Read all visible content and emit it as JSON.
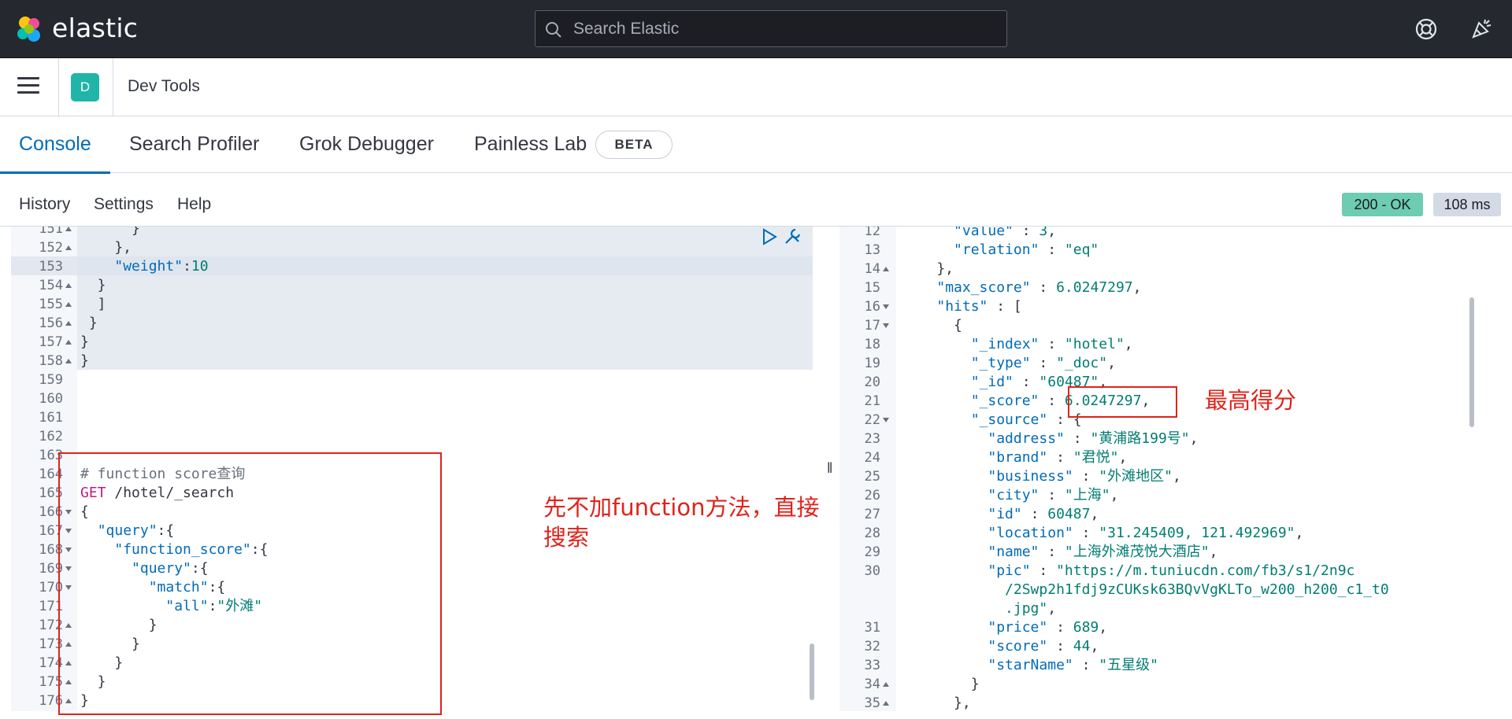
{
  "header": {
    "brand": "elastic",
    "search_placeholder": "Search Elastic",
    "icons": [
      "elastic-logo-icon",
      "search-icon",
      "help-icon",
      "newsfeed-icon"
    ]
  },
  "breadcrumb": {
    "avatar_letter": "D",
    "title": "Dev Tools"
  },
  "tabs": [
    {
      "label": "Console",
      "active": true
    },
    {
      "label": "Search Profiler"
    },
    {
      "label": "Grok Debugger"
    },
    {
      "label": "Painless Lab"
    }
  ],
  "beta_badge": "BETA",
  "menu": [
    "History",
    "Settings",
    "Help"
  ],
  "status": {
    "code": "200 - OK",
    "time": "108 ms"
  },
  "colors": {
    "accent": "#006bb8",
    "status_ok": "#6dccb1",
    "annotation": "#e0231b"
  },
  "left_editor": {
    "lines": [
      {
        "n": "151",
        "fold": "up",
        "indent": 2,
        "tokens": [
          [
            "p",
            "      }"
          ]
        ]
      },
      {
        "n": "152",
        "fold": "up",
        "tokens": [
          [
            "p",
            "    },"
          ]
        ]
      },
      {
        "n": "153",
        "tokens": [
          [
            "p",
            "    "
          ],
          [
            "k",
            "\"weight\""
          ],
          [
            "p",
            ":"
          ],
          [
            "s",
            "10"
          ]
        ]
      },
      {
        "n": "154",
        "fold": "up",
        "tokens": [
          [
            "p",
            "  }"
          ]
        ]
      },
      {
        "n": "155",
        "fold": "up",
        "tokens": [
          [
            "p",
            "  ]"
          ]
        ]
      },
      {
        "n": "156",
        "fold": "up",
        "tokens": [
          [
            "p",
            " }"
          ]
        ]
      },
      {
        "n": "157",
        "fold": "up",
        "tokens": [
          [
            "p",
            "}"
          ]
        ]
      },
      {
        "n": "158",
        "fold": "up",
        "tokens": [
          [
            "p",
            "}"
          ]
        ]
      },
      {
        "n": "159",
        "tokens": []
      },
      {
        "n": "160",
        "tokens": []
      },
      {
        "n": "161",
        "tokens": []
      },
      {
        "n": "162",
        "tokens": []
      },
      {
        "n": "163",
        "tokens": []
      },
      {
        "n": "164",
        "tokens": [
          [
            "c",
            "# function score查询"
          ]
        ]
      },
      {
        "n": "165",
        "tokens": [
          [
            "m",
            "GET"
          ],
          [
            "p",
            " /hotel/_search"
          ]
        ]
      },
      {
        "n": "166",
        "fold": "down",
        "tokens": [
          [
            "p",
            "{"
          ]
        ]
      },
      {
        "n": "167",
        "fold": "down",
        "tokens": [
          [
            "p",
            "  "
          ],
          [
            "k",
            "\"query\""
          ],
          [
            "p",
            ":{"
          ]
        ]
      },
      {
        "n": "168",
        "fold": "down",
        "tokens": [
          [
            "p",
            "    "
          ],
          [
            "k",
            "\"function_score\""
          ],
          [
            "p",
            ":{"
          ]
        ]
      },
      {
        "n": "169",
        "fold": "down",
        "tokens": [
          [
            "p",
            "      "
          ],
          [
            "k",
            "\"query\""
          ],
          [
            "p",
            ":{"
          ]
        ]
      },
      {
        "n": "170",
        "fold": "down",
        "tokens": [
          [
            "p",
            "        "
          ],
          [
            "k",
            "\"match\""
          ],
          [
            "p",
            ":{"
          ]
        ]
      },
      {
        "n": "171",
        "tokens": [
          [
            "p",
            "          "
          ],
          [
            "k",
            "\"all\""
          ],
          [
            "p",
            ":"
          ],
          [
            "s",
            "\"外滩\""
          ]
        ]
      },
      {
        "n": "172",
        "fold": "up",
        "tokens": [
          [
            "p",
            "        }"
          ]
        ]
      },
      {
        "n": "173",
        "fold": "up",
        "tokens": [
          [
            "p",
            "      }"
          ]
        ]
      },
      {
        "n": "174",
        "fold": "up",
        "tokens": [
          [
            "p",
            "    }"
          ]
        ]
      },
      {
        "n": "175",
        "fold": "up",
        "tokens": [
          [
            "p",
            "  }"
          ]
        ]
      },
      {
        "n": "176",
        "fold": "up",
        "tokens": [
          [
            "p",
            "}"
          ]
        ]
      }
    ]
  },
  "right_editor": {
    "lines": [
      {
        "n": "12",
        "tokens": [
          [
            "p",
            "      "
          ],
          [
            "k",
            "\"value\""
          ],
          [
            "p",
            " : "
          ],
          [
            "s",
            "3"
          ],
          [
            "p",
            ","
          ]
        ]
      },
      {
        "n": "13",
        "tokens": [
          [
            "p",
            "      "
          ],
          [
            "k",
            "\"relation\""
          ],
          [
            "p",
            " : "
          ],
          [
            "s",
            "\"eq\""
          ]
        ]
      },
      {
        "n": "14",
        "fold": "up",
        "tokens": [
          [
            "p",
            "    },"
          ]
        ]
      },
      {
        "n": "15",
        "tokens": [
          [
            "p",
            "    "
          ],
          [
            "k",
            "\"max_score\""
          ],
          [
            "p",
            " : "
          ],
          [
            "s",
            "6.0247297"
          ],
          [
            "p",
            ","
          ]
        ]
      },
      {
        "n": "16",
        "fold": "down",
        "tokens": [
          [
            "p",
            "    "
          ],
          [
            "k",
            "\"hits\""
          ],
          [
            "p",
            " : ["
          ]
        ]
      },
      {
        "n": "17",
        "fold": "down",
        "tokens": [
          [
            "p",
            "      {"
          ]
        ]
      },
      {
        "n": "18",
        "tokens": [
          [
            "p",
            "        "
          ],
          [
            "k",
            "\"_index\""
          ],
          [
            "p",
            " : "
          ],
          [
            "s",
            "\"hotel\""
          ],
          [
            "p",
            ","
          ]
        ]
      },
      {
        "n": "19",
        "tokens": [
          [
            "p",
            "        "
          ],
          [
            "k",
            "\"_type\""
          ],
          [
            "p",
            " : "
          ],
          [
            "s",
            "\"_doc\""
          ],
          [
            "p",
            ","
          ]
        ]
      },
      {
        "n": "20",
        "tokens": [
          [
            "p",
            "        "
          ],
          [
            "k",
            "\"_id\""
          ],
          [
            "p",
            " : "
          ],
          [
            "s",
            "\"60487\""
          ],
          [
            "p",
            ","
          ]
        ]
      },
      {
        "n": "21",
        "tokens": [
          [
            "p",
            "        "
          ],
          [
            "k",
            "\"_score\""
          ],
          [
            "p",
            " : "
          ],
          [
            "s",
            "6.0247297"
          ],
          [
            "p",
            ","
          ]
        ]
      },
      {
        "n": "22",
        "fold": "down",
        "tokens": [
          [
            "p",
            "        "
          ],
          [
            "k",
            "\"_source\""
          ],
          [
            "p",
            " : {"
          ]
        ]
      },
      {
        "n": "23",
        "tokens": [
          [
            "p",
            "          "
          ],
          [
            "k",
            "\"address\""
          ],
          [
            "p",
            " : "
          ],
          [
            "s",
            "\"黄浦路199号\""
          ],
          [
            "p",
            ","
          ]
        ]
      },
      {
        "n": "24",
        "tokens": [
          [
            "p",
            "          "
          ],
          [
            "k",
            "\"brand\""
          ],
          [
            "p",
            " : "
          ],
          [
            "s",
            "\"君悦\""
          ],
          [
            "p",
            ","
          ]
        ]
      },
      {
        "n": "25",
        "tokens": [
          [
            "p",
            "          "
          ],
          [
            "k",
            "\"business\""
          ],
          [
            "p",
            " : "
          ],
          [
            "s",
            "\"外滩地区\""
          ],
          [
            "p",
            ","
          ]
        ]
      },
      {
        "n": "26",
        "tokens": [
          [
            "p",
            "          "
          ],
          [
            "k",
            "\"city\""
          ],
          [
            "p",
            " : "
          ],
          [
            "s",
            "\"上海\""
          ],
          [
            "p",
            ","
          ]
        ]
      },
      {
        "n": "27",
        "tokens": [
          [
            "p",
            "          "
          ],
          [
            "k",
            "\"id\""
          ],
          [
            "p",
            " : "
          ],
          [
            "s",
            "60487"
          ],
          [
            "p",
            ","
          ]
        ]
      },
      {
        "n": "28",
        "tokens": [
          [
            "p",
            "          "
          ],
          [
            "k",
            "\"location\""
          ],
          [
            "p",
            " : "
          ],
          [
            "s",
            "\"31.245409, 121.492969\""
          ],
          [
            "p",
            ","
          ]
        ]
      },
      {
        "n": "29",
        "tokens": [
          [
            "p",
            "          "
          ],
          [
            "k",
            "\"name\""
          ],
          [
            "p",
            " : "
          ],
          [
            "s",
            "\"上海外滩茂悦大酒店\""
          ],
          [
            "p",
            ","
          ]
        ]
      },
      {
        "n": "30",
        "tokens": [
          [
            "p",
            "          "
          ],
          [
            "k",
            "\"pic\""
          ],
          [
            "p",
            " : "
          ],
          [
            "s",
            "\"https://m.tuniucdn.com/fb3/s1/2n9c"
          ]
        ]
      },
      {
        "n": "",
        "tokens": [
          [
            "s",
            "            /2Swp2h1fdj9zCUKsk63BQvVgKLTo_w200_h200_c1_t0"
          ]
        ]
      },
      {
        "n": "",
        "tokens": [
          [
            "s",
            "            .jpg\""
          ],
          [
            "p",
            ","
          ]
        ]
      },
      {
        "n": "31",
        "tokens": [
          [
            "p",
            "          "
          ],
          [
            "k",
            "\"price\""
          ],
          [
            "p",
            " : "
          ],
          [
            "s",
            "689"
          ],
          [
            "p",
            ","
          ]
        ]
      },
      {
        "n": "32",
        "tokens": [
          [
            "p",
            "          "
          ],
          [
            "k",
            "\"score\""
          ],
          [
            "p",
            " : "
          ],
          [
            "s",
            "44"
          ],
          [
            "p",
            ","
          ]
        ]
      },
      {
        "n": "33",
        "tokens": [
          [
            "p",
            "          "
          ],
          [
            "k",
            "\"starName\""
          ],
          [
            "p",
            " : "
          ],
          [
            "s",
            "\"五星级\""
          ]
        ]
      },
      {
        "n": "34",
        "fold": "up",
        "tokens": [
          [
            "p",
            "        }"
          ]
        ]
      },
      {
        "n": "35",
        "fold": "up",
        "tokens": [
          [
            "p",
            "      },"
          ]
        ]
      }
    ]
  },
  "annotations": {
    "left_note": "先不加function方法，直接搜索",
    "right_note": "最高得分"
  }
}
